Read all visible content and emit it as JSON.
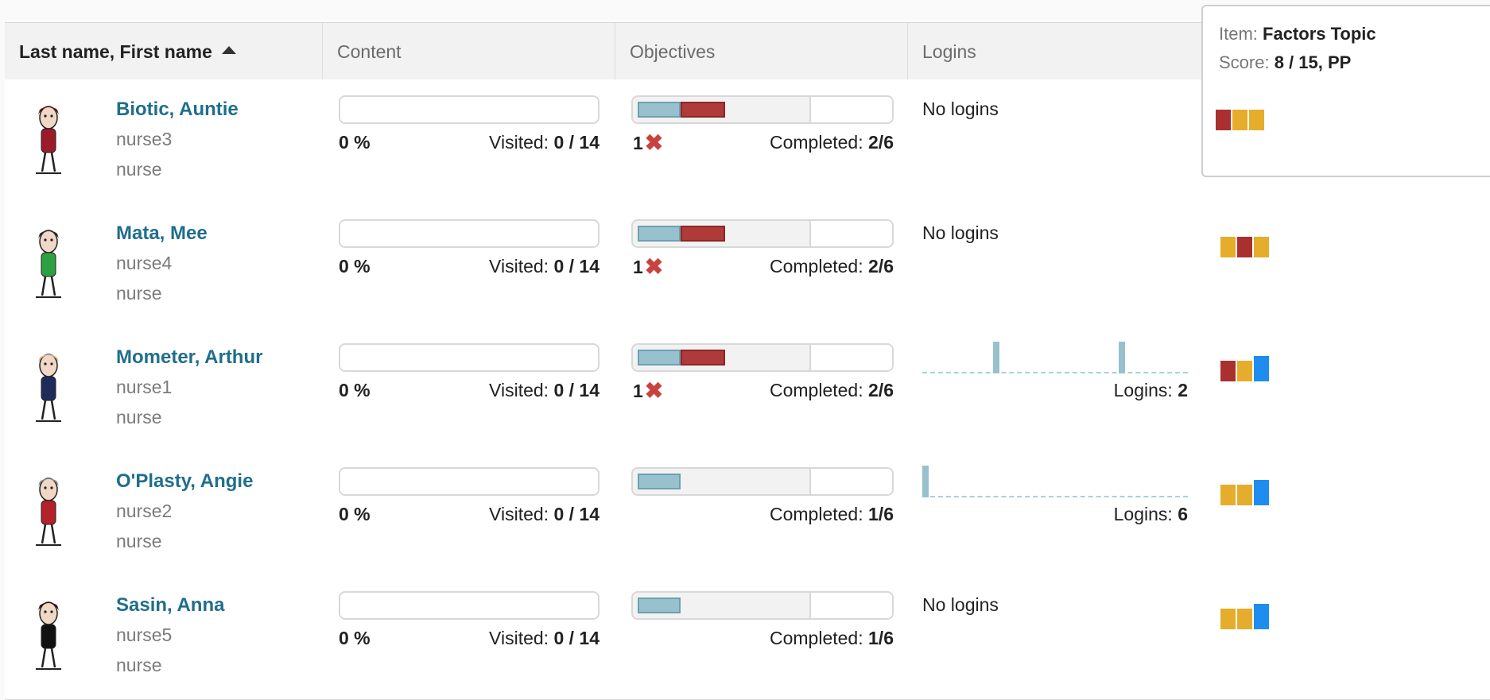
{
  "header": {
    "name_col": "Last name, First name",
    "content_col": "Content",
    "objectives_col": "Objectives",
    "logins_col": "Logins"
  },
  "labels": {
    "visited_prefix": "Visited: ",
    "completed_prefix": "Completed: ",
    "logins_prefix": "Logins: ",
    "no_logins": "No logins"
  },
  "colors": {
    "red": "#a9302f",
    "yellow": "#e5ad2b",
    "blue": "#1f8def",
    "link": "#1f6e8c"
  },
  "tooltip": {
    "item_label": "Item: ",
    "item_value": "Factors Topic",
    "score_label": "Score: ",
    "score_value": "8 / 15, PP",
    "scores": [
      "red",
      "yellow",
      "yellow"
    ]
  },
  "students": [
    {
      "name": "Biotic, Auntie",
      "username": "nurse3",
      "role": "nurse",
      "content_pct": "0 %",
      "visited": "0 / 14",
      "objectives_progress": 0.333,
      "failed_count": "1",
      "completed": "2/6",
      "logins_text": "No logins",
      "scores": [
        "red",
        "yellow",
        "yellow"
      ]
    },
    {
      "name": "Mata, Mee",
      "username": "nurse4",
      "role": "nurse",
      "content_pct": "0 %",
      "visited": "0 / 14",
      "objectives_progress": 0.333,
      "failed_count": "1",
      "completed": "2/6",
      "logins_text": "No logins",
      "scores": [
        "yellow",
        "red",
        "yellow"
      ]
    },
    {
      "name": "Mometer, Arthur",
      "username": "nurse1",
      "role": "nurse",
      "content_pct": "0 %",
      "visited": "0 / 14",
      "objectives_progress": 0.333,
      "failed_count": "1",
      "completed": "2/6",
      "logins_count": "2",
      "scores": [
        "red",
        "yellow",
        "blue"
      ]
    },
    {
      "name": "O'Plasty, Angie",
      "username": "nurse2",
      "role": "nurse",
      "content_pct": "0 %",
      "visited": "0 / 14",
      "objectives_progress": 0.167,
      "failed_count": "",
      "completed": "1/6",
      "logins_count": "6",
      "scores": [
        "yellow",
        "yellow",
        "blue"
      ]
    },
    {
      "name": "Sasin, Anna",
      "username": "nurse5",
      "role": "nurse",
      "content_pct": "0 %",
      "visited": "0 / 14",
      "objectives_progress": 0.167,
      "failed_count": "",
      "completed": "1/6",
      "logins_text": "No logins",
      "scores": [
        "yellow",
        "yellow",
        "blue"
      ]
    }
  ]
}
